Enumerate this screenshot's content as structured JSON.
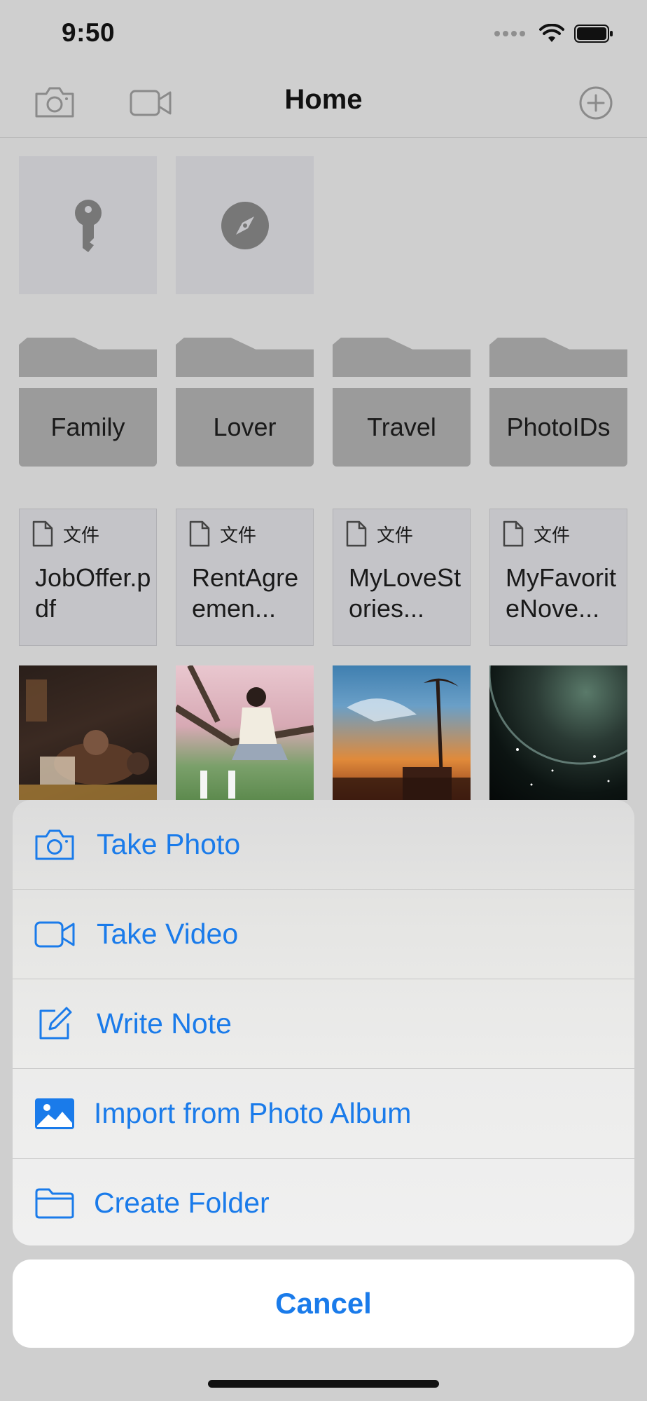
{
  "status_bar": {
    "time": "9:50"
  },
  "nav": {
    "title": "Home",
    "left_icons": [
      "camera-icon",
      "video-icon"
    ],
    "right_icon": "add-circle-icon"
  },
  "quick_tiles": [
    {
      "icon": "key-icon"
    },
    {
      "icon": "compass-icon"
    }
  ],
  "folders": [
    {
      "label": "Family"
    },
    {
      "label": "Lover"
    },
    {
      "label": "Travel"
    },
    {
      "label": "PhotoIDs"
    }
  ],
  "files": [
    {
      "type_label": "文件",
      "name": "JobOffer.pdf"
    },
    {
      "type_label": "文件",
      "name": "RentAgreemen..."
    },
    {
      "type_label": "文件",
      "name": "MyLoveStories..."
    },
    {
      "type_label": "文件",
      "name": "MyFavoriteNove..."
    }
  ],
  "photos": [
    {
      "subject": "indoor-scene"
    },
    {
      "subject": "girl-on-tree"
    },
    {
      "subject": "sunset-sky"
    },
    {
      "subject": "planet-space"
    }
  ],
  "action_sheet": {
    "items": [
      {
        "label": "Take Photo",
        "icon": "camera-icon"
      },
      {
        "label": "Take Video",
        "icon": "video-icon"
      },
      {
        "label": "Write Note",
        "icon": "edit-note-icon"
      },
      {
        "label": "Import from Photo Album",
        "icon": "photo-album-icon"
      },
      {
        "label": "Create Folder",
        "icon": "folder-icon"
      }
    ],
    "cancel_label": "Cancel"
  },
  "colors": {
    "accent": "#1a7bea",
    "dim_background": "#cfcfcf",
    "folder": "#9b9b9b",
    "tile": "#c4c4c8"
  }
}
